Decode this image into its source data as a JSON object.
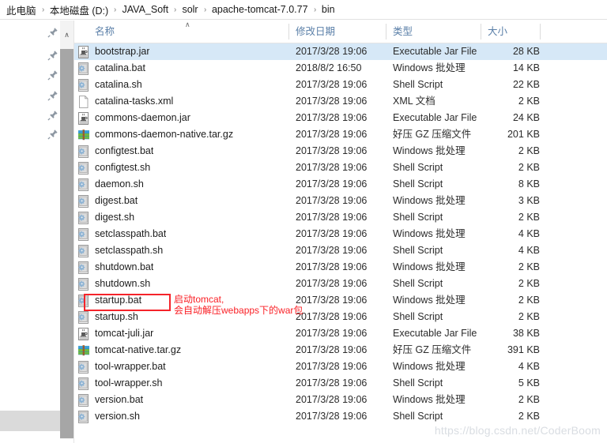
{
  "breadcrumb": {
    "separator": "›",
    "items": [
      {
        "label": "此电脑"
      },
      {
        "label": "本地磁盘 (D:)"
      },
      {
        "label": "JAVA_Soft"
      },
      {
        "label": "solr"
      },
      {
        "label": "apache-tomcat-7.0.77"
      },
      {
        "label": "bin"
      }
    ]
  },
  "nav_pane": {
    "pin_icon_count": 6,
    "pin_icon_name": "pin-icon"
  },
  "scrollbar": {
    "up_arrow_glyph": "∧",
    "position_percent": 0
  },
  "columns": {
    "name": "名称",
    "date_modified": "修改日期",
    "type": "类型",
    "size": "大小",
    "sort_caret": "∧"
  },
  "files": [
    {
      "name": "bootstrap.jar",
      "date": "2017/3/28 19:06",
      "type": "Executable Jar File",
      "size": "28 KB",
      "icon": "jar-file-icon",
      "selected": true
    },
    {
      "name": "catalina.bat",
      "date": "2018/8/2 16:50",
      "type": "Windows 批处理",
      "size": "14 KB",
      "icon": "bat-file-icon",
      "selected": false
    },
    {
      "name": "catalina.sh",
      "date": "2017/3/28 19:06",
      "type": "Shell Script",
      "size": "22 KB",
      "icon": "bat-file-icon",
      "selected": false
    },
    {
      "name": "catalina-tasks.xml",
      "date": "2017/3/28 19:06",
      "type": "XML 文档",
      "size": "2 KB",
      "icon": "xml-file-icon",
      "selected": false
    },
    {
      "name": "commons-daemon.jar",
      "date": "2017/3/28 19:06",
      "type": "Executable Jar File",
      "size": "24 KB",
      "icon": "jar-file-icon",
      "selected": false
    },
    {
      "name": "commons-daemon-native.tar.gz",
      "date": "2017/3/28 19:06",
      "type": "好压 GZ 压缩文件",
      "size": "201 KB",
      "icon": "archive-file-icon",
      "selected": false
    },
    {
      "name": "configtest.bat",
      "date": "2017/3/28 19:06",
      "type": "Windows 批处理",
      "size": "2 KB",
      "icon": "bat-file-icon",
      "selected": false
    },
    {
      "name": "configtest.sh",
      "date": "2017/3/28 19:06",
      "type": "Shell Script",
      "size": "2 KB",
      "icon": "bat-file-icon",
      "selected": false
    },
    {
      "name": "daemon.sh",
      "date": "2017/3/28 19:06",
      "type": "Shell Script",
      "size": "8 KB",
      "icon": "bat-file-icon",
      "selected": false
    },
    {
      "name": "digest.bat",
      "date": "2017/3/28 19:06",
      "type": "Windows 批处理",
      "size": "3 KB",
      "icon": "bat-file-icon",
      "selected": false
    },
    {
      "name": "digest.sh",
      "date": "2017/3/28 19:06",
      "type": "Shell Script",
      "size": "2 KB",
      "icon": "bat-file-icon",
      "selected": false
    },
    {
      "name": "setclasspath.bat",
      "date": "2017/3/28 19:06",
      "type": "Windows 批处理",
      "size": "4 KB",
      "icon": "bat-file-icon",
      "selected": false
    },
    {
      "name": "setclasspath.sh",
      "date": "2017/3/28 19:06",
      "type": "Shell Script",
      "size": "4 KB",
      "icon": "bat-file-icon",
      "selected": false
    },
    {
      "name": "shutdown.bat",
      "date": "2017/3/28 19:06",
      "type": "Windows 批处理",
      "size": "2 KB",
      "icon": "bat-file-icon",
      "selected": false
    },
    {
      "name": "shutdown.sh",
      "date": "2017/3/28 19:06",
      "type": "Shell Script",
      "size": "2 KB",
      "icon": "bat-file-icon",
      "selected": false
    },
    {
      "name": "startup.bat",
      "date": "2017/3/28 19:06",
      "type": "Windows 批处理",
      "size": "2 KB",
      "icon": "bat-file-icon",
      "selected": false
    },
    {
      "name": "startup.sh",
      "date": "2017/3/28 19:06",
      "type": "Shell Script",
      "size": "2 KB",
      "icon": "bat-file-icon",
      "selected": false
    },
    {
      "name": "tomcat-juli.jar",
      "date": "2017/3/28 19:06",
      "type": "Executable Jar File",
      "size": "38 KB",
      "icon": "jar-file-icon",
      "selected": false
    },
    {
      "name": "tomcat-native.tar.gz",
      "date": "2017/3/28 19:06",
      "type": "好压 GZ 压缩文件",
      "size": "391 KB",
      "icon": "archive-file-icon",
      "selected": false
    },
    {
      "name": "tool-wrapper.bat",
      "date": "2017/3/28 19:06",
      "type": "Windows 批处理",
      "size": "4 KB",
      "icon": "bat-file-icon",
      "selected": false
    },
    {
      "name": "tool-wrapper.sh",
      "date": "2017/3/28 19:06",
      "type": "Shell Script",
      "size": "5 KB",
      "icon": "bat-file-icon",
      "selected": false
    },
    {
      "name": "version.bat",
      "date": "2017/3/28 19:06",
      "type": "Windows 批处理",
      "size": "2 KB",
      "icon": "bat-file-icon",
      "selected": false
    },
    {
      "name": "version.sh",
      "date": "2017/3/28 19:06",
      "type": "Shell Script",
      "size": "2 KB",
      "icon": "bat-file-icon",
      "selected": false
    }
  ],
  "annotation": {
    "target_file": "startup.bat",
    "text": "启动tomcat,\n会自动解压webapps下的war包",
    "color": "#fa1f25"
  },
  "watermark": {
    "text": "https://blog.csdn.net/CoderBoom"
  }
}
